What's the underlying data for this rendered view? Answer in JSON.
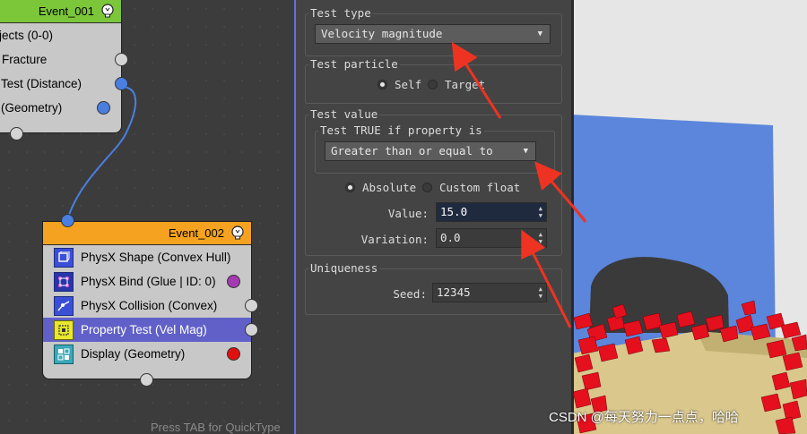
{
  "event1": {
    "title": "Event_001",
    "rows": [
      "jects (0-0)",
      "Fracture",
      "Test (Distance)",
      "(Geometry)"
    ]
  },
  "event2": {
    "title": "Event_002",
    "rows": [
      "PhysX Shape (Convex Hull)",
      "PhysX Bind (Glue | ID: 0)",
      "PhysX Collision (Convex)",
      "Property Test (Vel Mag)",
      "Display (Geometry)"
    ],
    "selected_row": "Property Test (Vel Mag)"
  },
  "editor": {
    "hint": "Press TAB for QuickType"
  },
  "params": {
    "test_type": {
      "title": "Test type",
      "value": "Velocity magnitude"
    },
    "test_particle": {
      "title": "Test particle",
      "options": [
        "Self",
        "Target"
      ],
      "selected": "Self"
    },
    "test_value": {
      "title": "Test value",
      "condition_title": "Test TRUE if property is",
      "condition": "Greater than or equal to",
      "modes": [
        "Absolute",
        "Custom float"
      ],
      "selected_mode": "Absolute",
      "value_label": "Value:",
      "value": "15.0",
      "variation_label": "Variation:",
      "variation": "0.0"
    },
    "uniqueness": {
      "title": "Uniqueness",
      "seed_label": "Seed:",
      "seed": "12345"
    }
  },
  "viewport": {
    "watermark": "CSDN @每天努力一点点，哈哈"
  },
  "colors": {
    "event1_header": "#7cc63a",
    "event2_header": "#f4a21f",
    "selection": "#6060c8",
    "annotation_arrow": "#ee3322",
    "wall": "#5b86db",
    "debris": "#e4101e",
    "floor": "#d9c78c"
  },
  "icons": [
    "lightbulb-icon",
    "physx-shape-icon",
    "physx-bind-icon",
    "physx-collision-icon",
    "property-test-icon",
    "display-icon"
  ]
}
